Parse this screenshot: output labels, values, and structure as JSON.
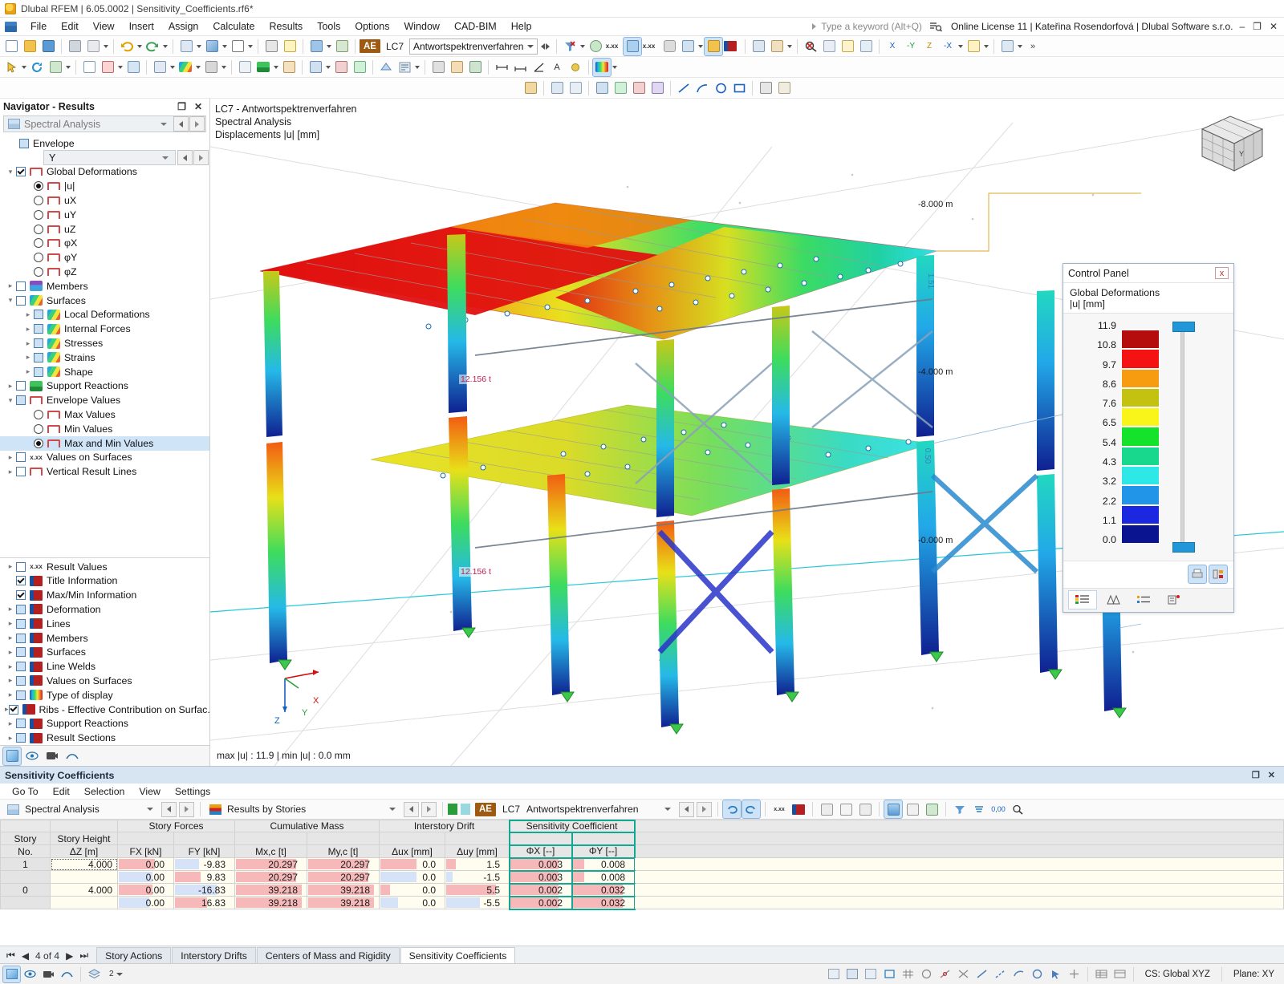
{
  "window": {
    "title": "Dlubal RFEM | 6.05.0002 | Sensitivity_Coefficients.rf6*",
    "app_icon": "dlubal-icon",
    "minimize": "–",
    "restore": "❐",
    "close": "✕"
  },
  "menubar": {
    "items": [
      "File",
      "Edit",
      "View",
      "Insert",
      "Assign",
      "Calculate",
      "Results",
      "Tools",
      "Options",
      "Window",
      "CAD-BIM",
      "Help"
    ],
    "search_placeholder": "Type a keyword (Alt+Q)",
    "license": "Online License 11 | Kateřina Rosendorfová | Dlubal Software s.r.o."
  },
  "toolbar": {
    "load_case_badge": "AE",
    "load_case": "LC7",
    "load_case_name": "Antwortspektrenverfahren",
    "accent": "#9c5a12"
  },
  "navigator": {
    "title": "Navigator - Results",
    "float_icon": "restore-icon",
    "close_icon": "close-icon",
    "analysis_combo": "Spectral Analysis",
    "envelope_label": "Envelope",
    "envelope_axis": "Y",
    "tree": [
      {
        "label": "Global Deformations",
        "type": "check",
        "state": "checked",
        "icon": "frame-icon",
        "indent": 0,
        "expander": "v"
      },
      {
        "label": "|u|",
        "type": "radio",
        "state": "on",
        "icon": "frame-icon",
        "indent": 1
      },
      {
        "label": "uX",
        "type": "radio",
        "state": "off",
        "icon": "frame-icon",
        "indent": 1
      },
      {
        "label": "uY",
        "type": "radio",
        "state": "off",
        "icon": "frame-icon",
        "indent": 1
      },
      {
        "label": "uZ",
        "type": "radio",
        "state": "off",
        "icon": "frame-icon",
        "indent": 1
      },
      {
        "label": "φX",
        "type": "radio",
        "state": "off",
        "icon": "frame-icon",
        "indent": 1
      },
      {
        "label": "φY",
        "type": "radio",
        "state": "off",
        "icon": "frame-icon",
        "indent": 1
      },
      {
        "label": "φZ",
        "type": "radio",
        "state": "off",
        "icon": "frame-icon",
        "indent": 1
      },
      {
        "label": "Members",
        "type": "check",
        "state": "unchecked",
        "icon": "member-icon",
        "indent": 0,
        "expander": ">"
      },
      {
        "label": "Surfaces",
        "type": "check",
        "state": "unchecked",
        "icon": "surface-icon",
        "indent": 0,
        "expander": "v"
      },
      {
        "label": "Local Deformations",
        "type": "check",
        "state": "blue",
        "icon": "surface-icon",
        "indent": 1,
        "expander": ">"
      },
      {
        "label": "Internal Forces",
        "type": "check",
        "state": "blue",
        "icon": "surface-icon",
        "indent": 1,
        "expander": ">"
      },
      {
        "label": "Stresses",
        "type": "check",
        "state": "blue",
        "icon": "surface-icon",
        "indent": 1,
        "expander": ">"
      },
      {
        "label": "Strains",
        "type": "check",
        "state": "blue",
        "icon": "surface-icon",
        "indent": 1,
        "expander": ">"
      },
      {
        "label": "Shape",
        "type": "check",
        "state": "blue",
        "icon": "surface-icon",
        "indent": 1,
        "expander": ">"
      },
      {
        "label": "Support Reactions",
        "type": "check",
        "state": "unchecked",
        "icon": "support-icon",
        "indent": 0,
        "expander": ">"
      },
      {
        "label": "Envelope Values",
        "type": "check",
        "state": "blue",
        "icon": "frame-icon",
        "indent": 0,
        "expander": "v"
      },
      {
        "label": "Max Values",
        "type": "radio",
        "state": "off",
        "icon": "frame-icon",
        "indent": 1
      },
      {
        "label": "Min Values",
        "type": "radio",
        "state": "off",
        "icon": "frame-icon",
        "indent": 1
      },
      {
        "label": "Max and Min Values",
        "type": "radio",
        "state": "on",
        "icon": "frame-icon",
        "indent": 1,
        "selected": true
      },
      {
        "label": "Values on Surfaces",
        "type": "check",
        "state": "unchecked",
        "icon": "xx-icon",
        "indent": 0,
        "expander": ">"
      },
      {
        "label": "Vertical Result Lines",
        "type": "check",
        "state": "unchecked",
        "icon": "frame-icon",
        "indent": 0,
        "expander": ">"
      }
    ],
    "tree_bottom": [
      {
        "label": "Result Values",
        "type": "check",
        "state": "unchecked",
        "icon": "xxx-icon",
        "expander": ">"
      },
      {
        "label": "Title Information",
        "type": "check",
        "state": "checked",
        "icon": "display-icon",
        "expander": ""
      },
      {
        "label": "Max/Min Information",
        "type": "check",
        "state": "checked",
        "icon": "display-icon",
        "expander": ""
      },
      {
        "label": "Deformation",
        "type": "check",
        "state": "blue",
        "icon": "display-icon",
        "expander": ">"
      },
      {
        "label": "Lines",
        "type": "check",
        "state": "blue",
        "icon": "display-icon",
        "expander": ">"
      },
      {
        "label": "Members",
        "type": "check",
        "state": "blue",
        "icon": "display-icon",
        "expander": ">"
      },
      {
        "label": "Surfaces",
        "type": "check",
        "state": "blue",
        "icon": "display-icon",
        "expander": ">"
      },
      {
        "label": "Line Welds",
        "type": "check",
        "state": "blue",
        "icon": "display-icon",
        "expander": ">"
      },
      {
        "label": "Values on Surfaces",
        "type": "check",
        "state": "blue",
        "icon": "display-icon",
        "expander": ">"
      },
      {
        "label": "Type of display",
        "type": "check",
        "state": "blue",
        "icon": "rainbow-icon",
        "expander": ">"
      },
      {
        "label": "Ribs - Effective Contribution on Surfac...",
        "type": "check",
        "state": "checked",
        "icon": "display-icon",
        "expander": ">"
      },
      {
        "label": "Support Reactions",
        "type": "check",
        "state": "blue",
        "icon": "display-icon",
        "expander": ">"
      },
      {
        "label": "Result Sections",
        "type": "check",
        "state": "blue",
        "icon": "display-icon",
        "expander": ">"
      }
    ]
  },
  "viewport": {
    "title_lines": "LC7 - Antwortspektrenverfahren\nSpectral Analysis\nDisplacements |u| [mm]",
    "minmax": "max |u| : 11.9 | min |u| : 0.0 mm",
    "axis_x": "X",
    "axis_y": "Y",
    "axis_z": "Z",
    "dim_top": "-8.000 m",
    "dim_mid": "-4.000 m",
    "dim_bottom": "-0.000 m",
    "level_labels": [
      "1.51",
      "0.50"
    ],
    "result_label_1": "12.156 t",
    "result_label_2": "12.156 t"
  },
  "control_panel": {
    "title": "Control Panel",
    "close": "x",
    "subtitle_line1": "Global Deformations",
    "subtitle_line2": "|u| [mm]",
    "legend_values": [
      "11.9",
      "10.8",
      "9.7",
      "8.6",
      "7.6",
      "6.5",
      "5.4",
      "4.3",
      "3.2",
      "2.2",
      "1.1",
      "0.0"
    ],
    "legend_colors": [
      "#b50d0d",
      "#f41212",
      "#f79c10",
      "#c3c211",
      "#f9f51a",
      "#14e22b",
      "#17d88c",
      "#2ee8e8",
      "#2196e8",
      "#1b28e0",
      "#0b1490"
    ],
    "slider_color": "#2196d8",
    "footer_icons": [
      "print-icon",
      "settings-icon"
    ],
    "tabs": [
      "legend-tab",
      "scale-tab",
      "list-tab",
      "factors-tab"
    ]
  },
  "table_panel": {
    "title": "Sensitivity Coefficients",
    "menu": [
      "Go To",
      "Edit",
      "Selection",
      "View",
      "Settings"
    ],
    "analysis_combo": "Spectral Analysis",
    "results_combo": "Results by Stories",
    "lc_badge": "AE",
    "lc": "LC7",
    "lc_name": "Antwortspektrenverfahren",
    "highlight_color": "#12a892",
    "groups": [
      {
        "label": "",
        "span": 1
      },
      {
        "label": "",
        "span": 1
      },
      {
        "label": "Story Forces",
        "span": 2
      },
      {
        "label": "Cumulative Mass",
        "span": 2
      },
      {
        "label": "Interstory Drift",
        "span": 2
      },
      {
        "label": "Sensitivity Coefficient",
        "span": 2,
        "highlight": true
      },
      {
        "label": "",
        "span": 1
      }
    ],
    "headers_top": [
      "Story",
      "Story Height",
      "Story Forces",
      "Cumulative Mass",
      "Interstory Drift",
      "Sensitivity Coefficient"
    ],
    "columns": [
      {
        "top": "Story",
        "bot": "No."
      },
      {
        "top": "Story Height",
        "bot": "ΔZ [m]"
      },
      {
        "top": "",
        "bot": "FX [kN]"
      },
      {
        "top": "",
        "bot": "FY [kN]"
      },
      {
        "top": "",
        "bot": "Mx,c [t]"
      },
      {
        "top": "",
        "bot": "My,c [t]"
      },
      {
        "top": "",
        "bot": "Δux [mm]"
      },
      {
        "top": "",
        "bot": "Δuy [mm]"
      },
      {
        "top": "",
        "bot": "ΦX [--]"
      },
      {
        "top": "",
        "bot": "ΦY [--]"
      }
    ],
    "rows": [
      {
        "story": "1",
        "height": "4.000",
        "fx": "0.00",
        "fy": "-9.83",
        "mxc": "20.297",
        "myc": "20.297",
        "dux": "0.0",
        "duy": "1.5",
        "phix": "0.003",
        "phiy": "0.008",
        "bars": {
          "height": "none",
          "fx": "red",
          "fy": "blue",
          "mxc": "red",
          "myc": "red",
          "dux": "red",
          "duy": "red",
          "phix": "red",
          "phiy": "red"
        },
        "barw": {
          "fx": 45,
          "fy": 30,
          "mxc": 75,
          "myc": 75,
          "dux": 45,
          "duy": 12,
          "phix": 60,
          "phiy": 14
        },
        "height_focus": true
      },
      {
        "story": "",
        "height": "",
        "fx": "0.00",
        "fy": "9.83",
        "mxc": "20.297",
        "myc": "20.297",
        "dux": "0.0",
        "duy": "-1.5",
        "phix": "0.003",
        "phiy": "0.008",
        "bars": {
          "height": "none",
          "fx": "blue",
          "fy": "red",
          "mxc": "red",
          "myc": "red",
          "dux": "blue",
          "duy": "blue",
          "phix": "red",
          "phiy": "red"
        },
        "barw": {
          "fx": 42,
          "fy": 32,
          "mxc": 75,
          "myc": 75,
          "dux": 45,
          "duy": 8,
          "phix": 60,
          "phiy": 14
        }
      },
      {
        "story": "0",
        "height": "4.000",
        "fx": "0.00",
        "fy": "-16.83",
        "mxc": "39.218",
        "myc": "39.218",
        "dux": "0.0",
        "duy": "5.5",
        "phix": "0.002",
        "phiy": "0.032",
        "bars": {
          "height": "none",
          "fx": "red",
          "fy": "blue",
          "mxc": "red",
          "myc": "red",
          "dux": "red",
          "duy": "red",
          "phix": "red",
          "phiy": "red"
        },
        "barw": {
          "fx": 42,
          "fy": 52,
          "mxc": 82,
          "myc": 82,
          "dux": 12,
          "duy": 62,
          "phix": 60,
          "phiy": 62
        }
      },
      {
        "story": "",
        "height": "",
        "fx": "0.00",
        "fy": "16.83",
        "mxc": "39.218",
        "myc": "39.218",
        "dux": "0.0",
        "duy": "-5.5",
        "phix": "0.002",
        "phiy": "0.032",
        "bars": {
          "height": "none",
          "fx": "blue",
          "fy": "red",
          "mxc": "red",
          "myc": "red",
          "dux": "blue",
          "duy": "blue",
          "phix": "red",
          "phiy": "red"
        },
        "barw": {
          "fx": 38,
          "fy": 40,
          "mxc": 82,
          "myc": 82,
          "dux": 22,
          "duy": 42,
          "phix": 60,
          "phiy": 62
        }
      }
    ],
    "pager": "4 of 4",
    "pager_first": "⏮",
    "pager_prev": "◀",
    "pager_next": "▶",
    "pager_last": "⏭",
    "tabs": [
      "Story Actions",
      "Interstory Drifts",
      "Centers of Mass and Rigidity",
      "Sensitivity Coefficients"
    ],
    "active_tab": "Sensitivity Coefficients"
  },
  "statusbar": {
    "cs_label": "CS: Global XYZ",
    "plane_label": "Plane: XY",
    "snap_value": "0,00"
  }
}
